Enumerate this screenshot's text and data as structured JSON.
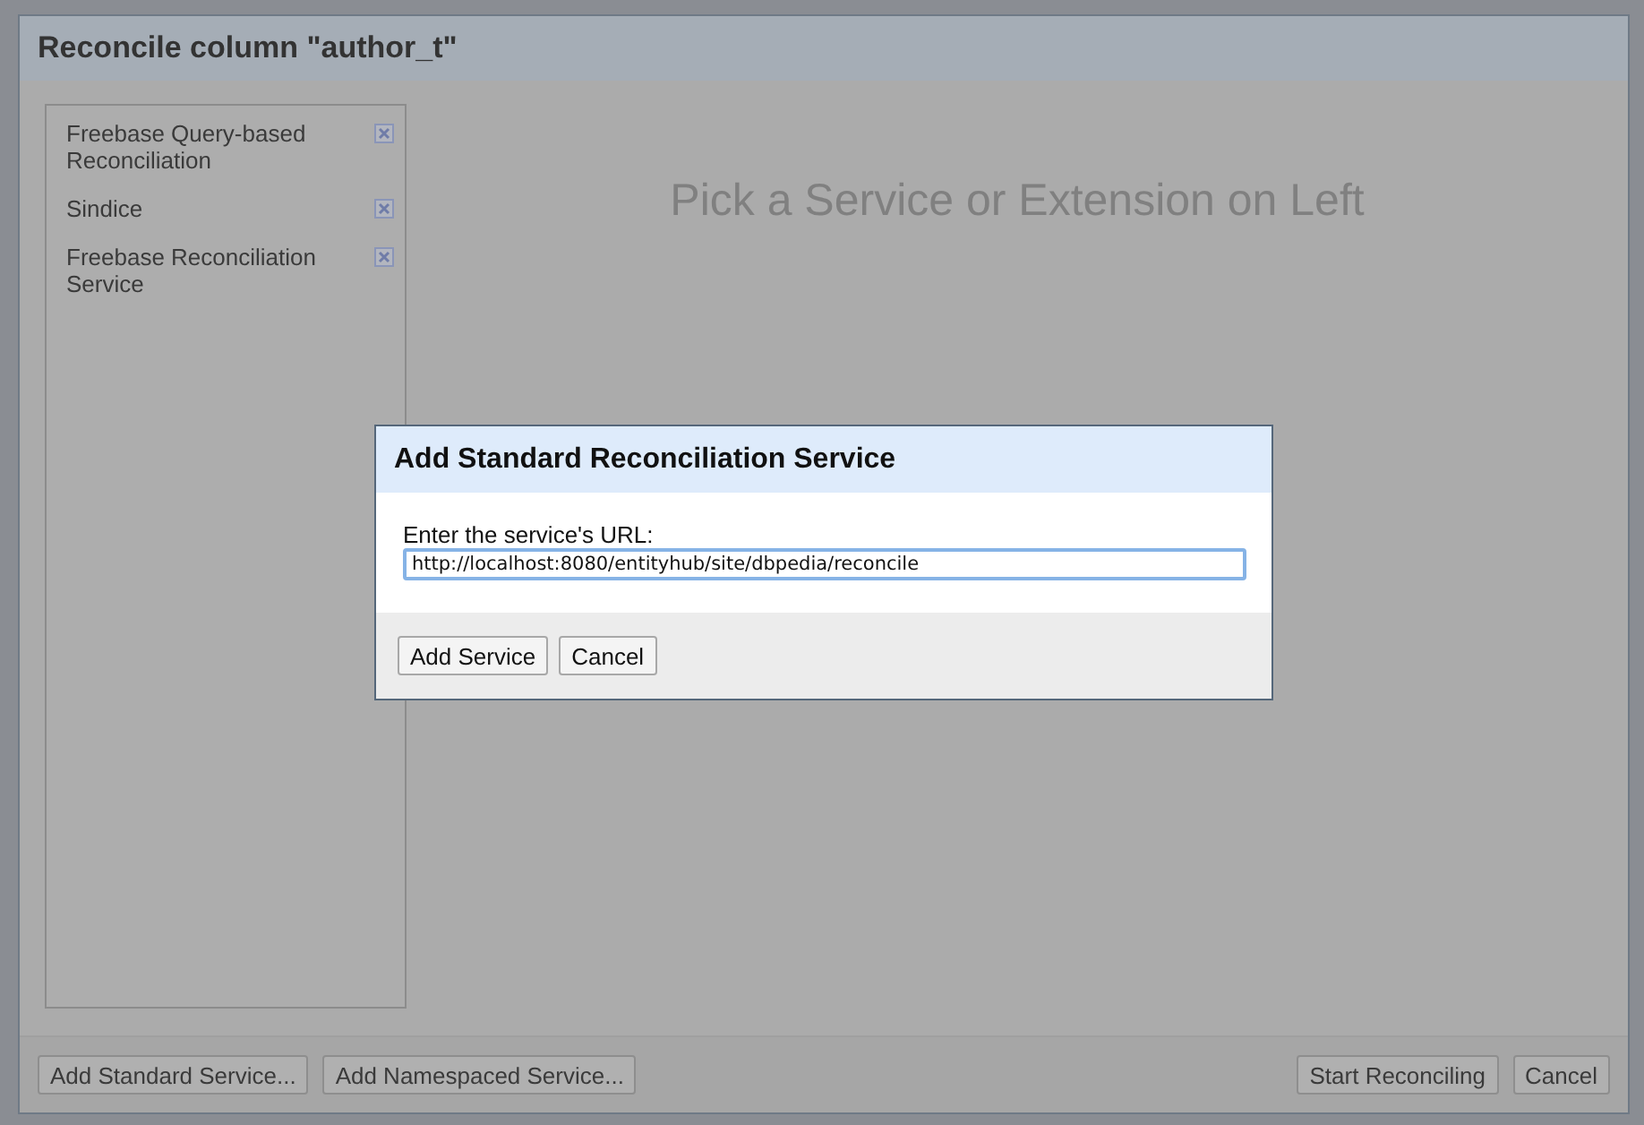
{
  "dialog": {
    "title": "Reconcile column \"author_t\"",
    "services": [
      {
        "name": "Freebase Query-based Reconciliation"
      },
      {
        "name": "Sindice"
      },
      {
        "name": "Freebase Reconciliation Service"
      }
    ],
    "placeholder_message": "Pick a Service or Extension on Left",
    "footer_left": [
      "Add Standard Service...",
      "Add Namespaced Service..."
    ],
    "footer_right": [
      "Start Reconciling",
      "Cancel"
    ]
  },
  "modal": {
    "title": "Add Standard Reconciliation Service",
    "label": "Enter the service's URL:",
    "url": "http://localhost:8080/entityhub/site/dbpedia/reconcile",
    "buttons": [
      "Add Service",
      "Cancel"
    ]
  }
}
